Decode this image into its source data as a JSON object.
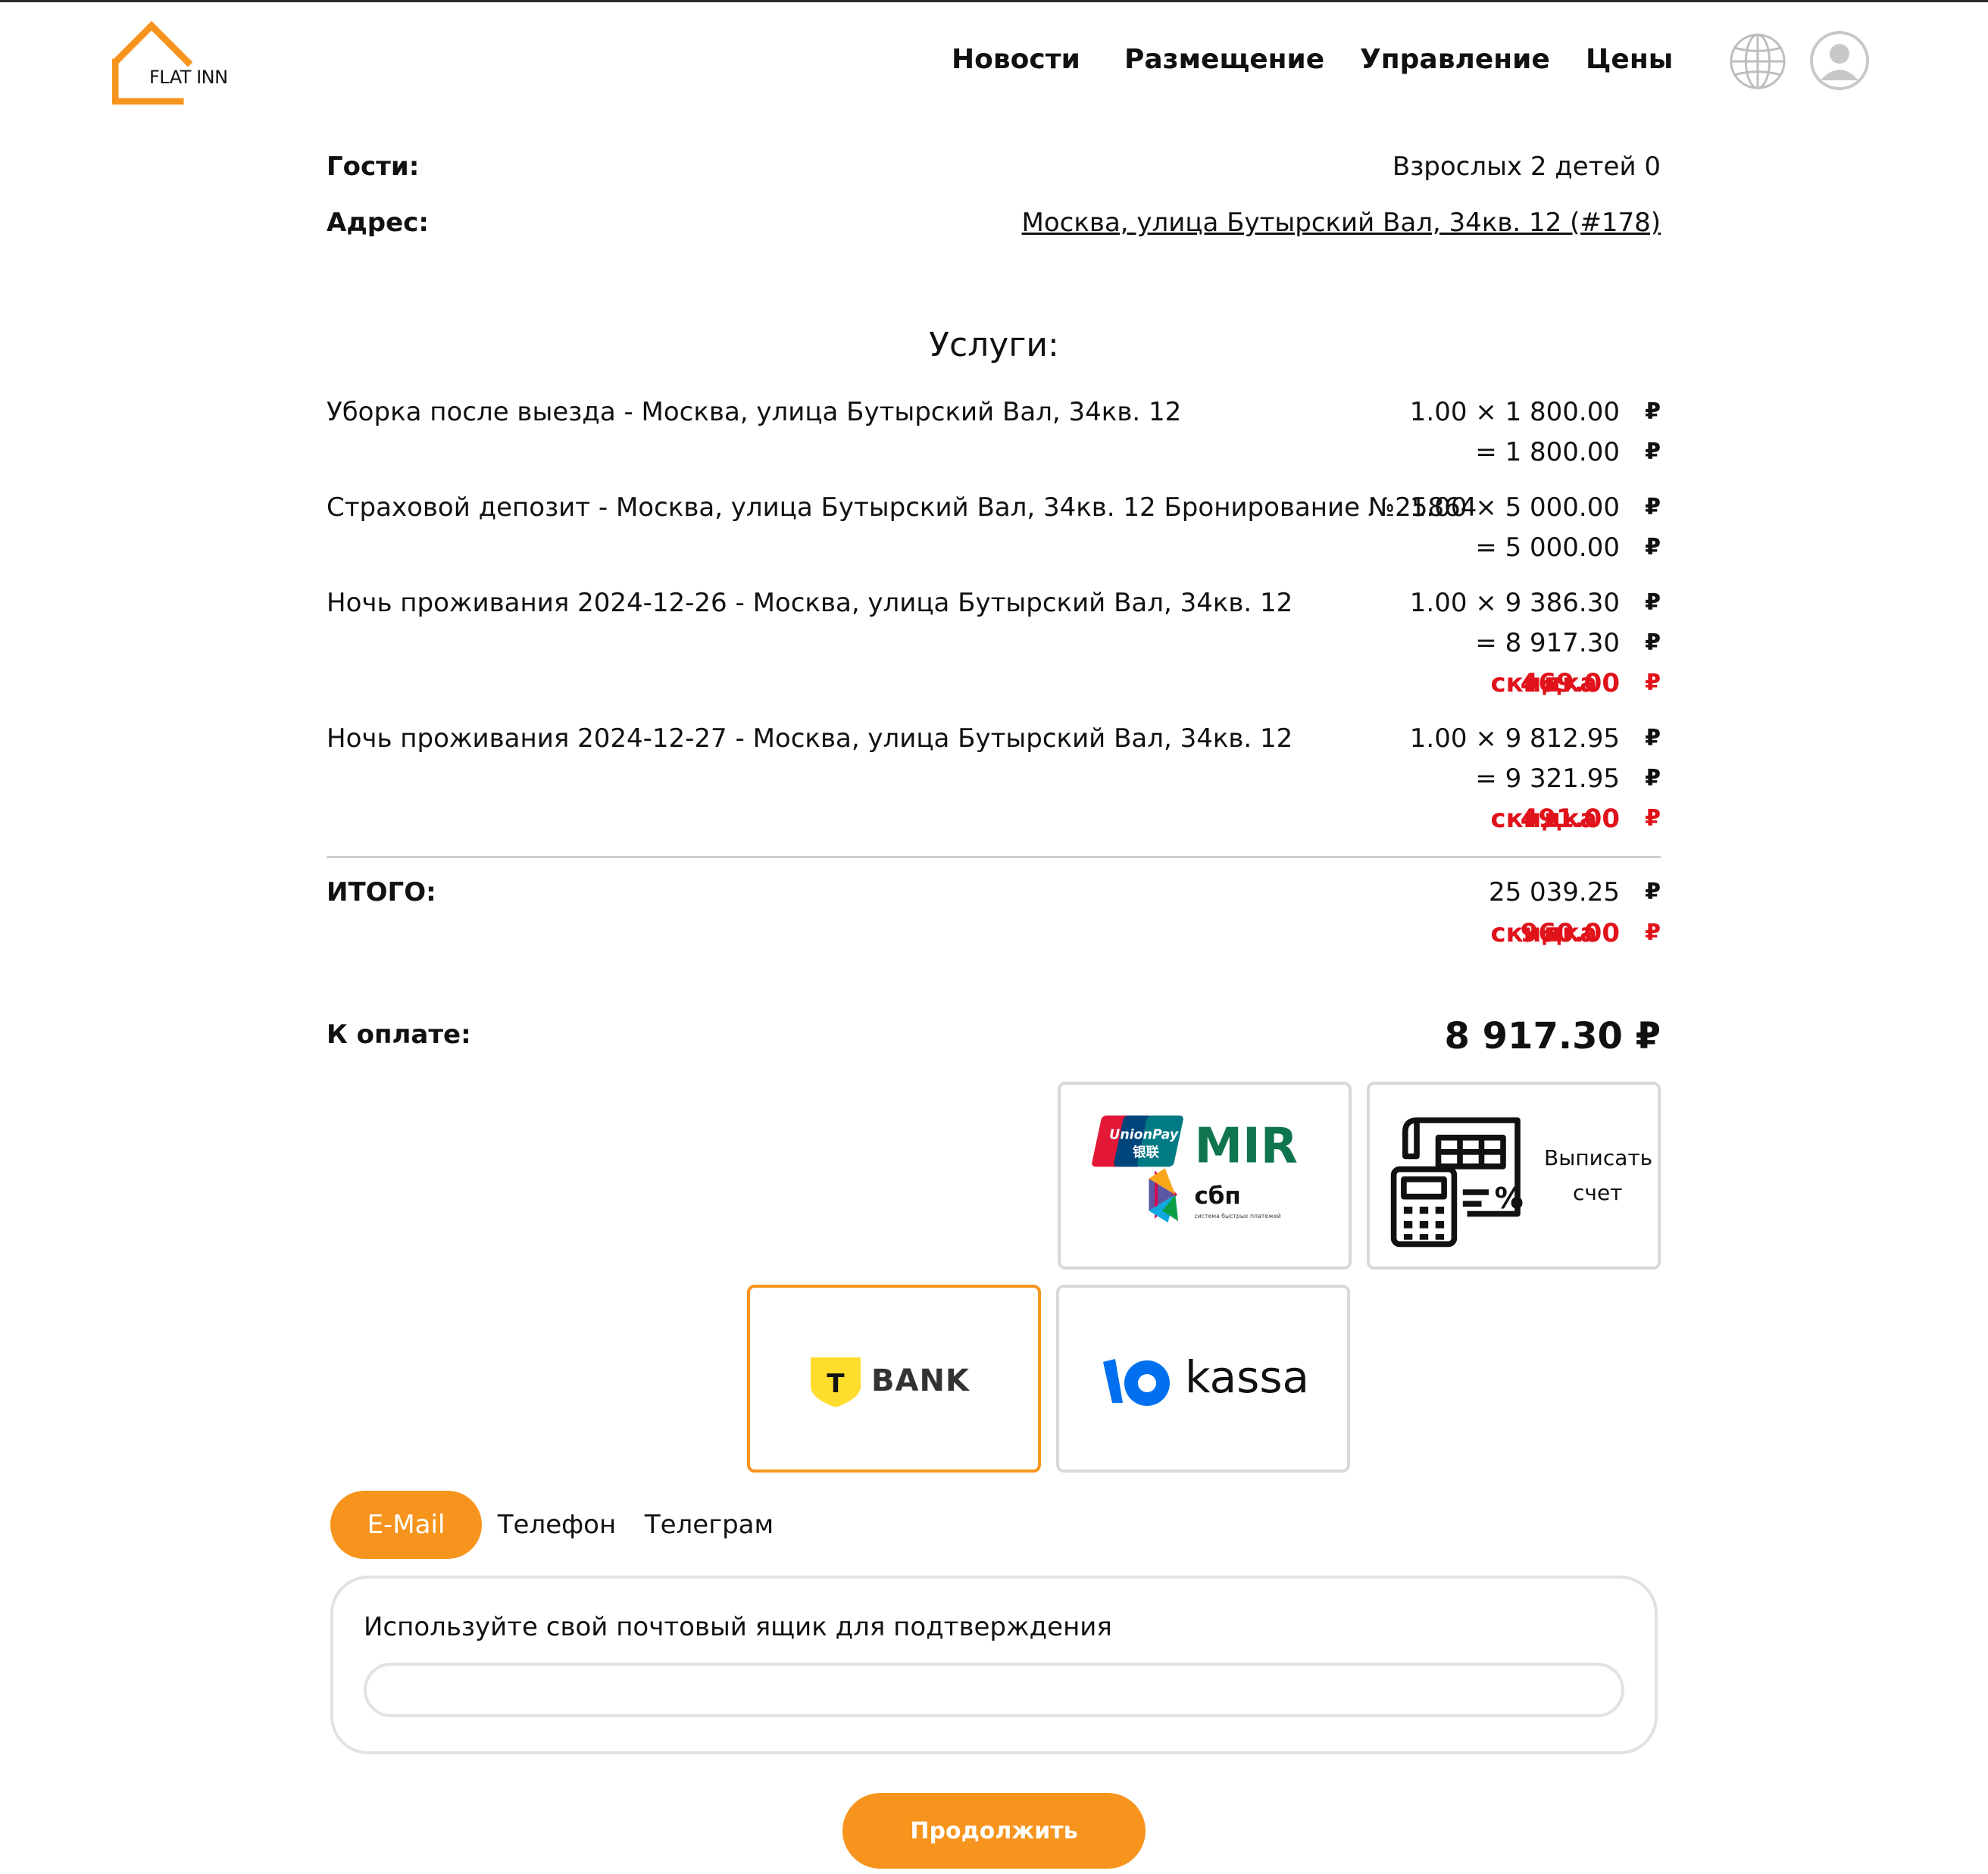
{
  "brand": {
    "name": "FLAT INN",
    "accent": "#f7941d",
    "discount_color": "#e0121a"
  },
  "nav": {
    "items": [
      {
        "label": "Новости"
      },
      {
        "label": "Размещение"
      },
      {
        "label": "Управление"
      },
      {
        "label": "Цены"
      }
    ],
    "language_icon": "globe-icon",
    "profile_icon": "user-avatar-icon"
  },
  "booking": {
    "guests_label": "Гости:",
    "guests_value": "Взрослых 2 детей 0",
    "address_label": "Адрес:",
    "address_value": "Москва, улица Бутырский Вал, 34кв. 12 (#178)"
  },
  "services": {
    "title": "Услуги:",
    "currency": "₽",
    "discount_label": "скидка",
    "items": [
      {
        "name": "Уборка после выезда - Москва, улица Бутырский Вал, 34кв. 12",
        "qty_price": "1.00 × 1 800.00",
        "total": "= 1 800.00"
      },
      {
        "name": "Страховой депозит - Москва, улица Бутырский Вал, 34кв. 12 Бронирование №25864",
        "qty_price": "1.00 × 5 000.00",
        "total": "= 5 000.00"
      },
      {
        "name": "Ночь проживания 2024-12-26 - Москва, улица Бутырский Вал, 34кв. 12",
        "qty_price": "1.00 × 9 386.30",
        "total": "= 8 917.30",
        "discount": "469.00"
      },
      {
        "name": "Ночь проживания 2024-12-27 - Москва, улица Бутырский Вал, 34кв. 12",
        "qty_price": "1.00 × 9 812.95",
        "total": "= 9 321.95",
        "discount": "491.00"
      }
    ]
  },
  "totals": {
    "label": "ИТОГО:",
    "sum": "25 039.25",
    "discount": "960.00",
    "to_pay_label": "К оплате:",
    "to_pay": "8 917.30 ₽"
  },
  "payment_methods": {
    "cards": {
      "unionpay": "UnionPay",
      "unionpay_cn": "银联",
      "mir": "MIR",
      "sbp": "сбп",
      "sbp_sub": "система быстрых платежей"
    },
    "invoice": {
      "line1": "Выписать",
      "line2": "счет",
      "icon": "invoice-calculator-icon"
    },
    "tbank": {
      "letter": "T",
      "label": "BANK"
    },
    "yookassa": {
      "label": "kassa"
    }
  },
  "contact": {
    "tabs": [
      {
        "label": "E-Mail"
      },
      {
        "label": "Телефон"
      },
      {
        "label": "Телеграм"
      }
    ],
    "active_tab": "E-Mail",
    "prompt": "Используйте свой почтовый ящик для подтверждения",
    "email_value": "",
    "email_placeholder": ""
  },
  "continue_button": "Продолжить"
}
